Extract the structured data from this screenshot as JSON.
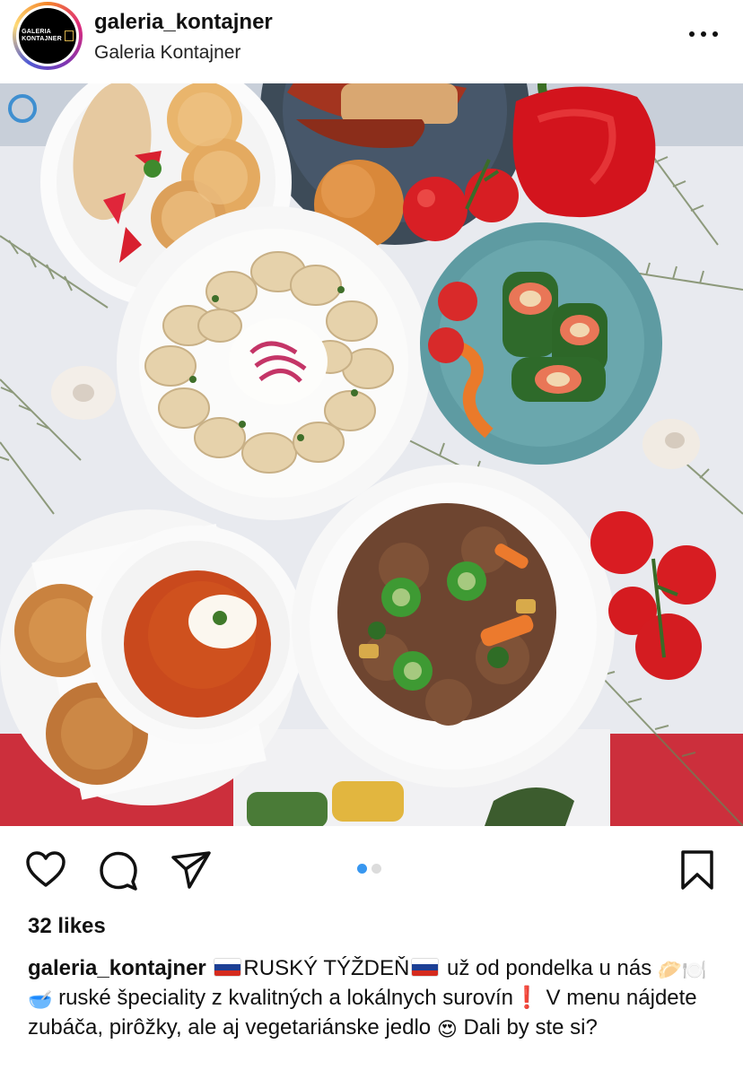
{
  "header": {
    "username": "galeria_kontajner",
    "location": "Galeria Kontajner",
    "avatar_text_line1": "GALERIA",
    "avatar_text_line2": "KONTAJNER"
  },
  "carousel": {
    "count": 2,
    "active_index": 0
  },
  "post": {
    "likes": "32 likes",
    "caption_user": "galeria_kontajner",
    "caption_part1": "RUSKÝ TÝŽDEŇ",
    "caption_part2": "už od pondelka u nás",
    "caption_emoji_dumpling": "🥟",
    "caption_emoji_plate": "🍽️",
    "caption_emoji_bowl": "🥣",
    "caption_part3": "ruské špeciality z kvalitných a lokálnych surovín",
    "caption_exclaim": "❗",
    "caption_part4": "V menu nájdete zubáča, pirôžky, ale aj vegetariánske jedlo",
    "caption_emoji_heart_eyes": "😍",
    "caption_part5": "Dali by ste si?"
  },
  "icons": {
    "like": "heart-icon",
    "comment": "comment-icon",
    "share": "paper-plane-icon",
    "save": "bookmark-icon",
    "more": "more-dots-icon"
  },
  "colors": {
    "carousel_active": "#3897f0",
    "carousel_inactive": "#dcdcdc",
    "flag_white": "#ffffff",
    "flag_blue": "#1c3f94",
    "flag_red": "#d52b1e"
  }
}
